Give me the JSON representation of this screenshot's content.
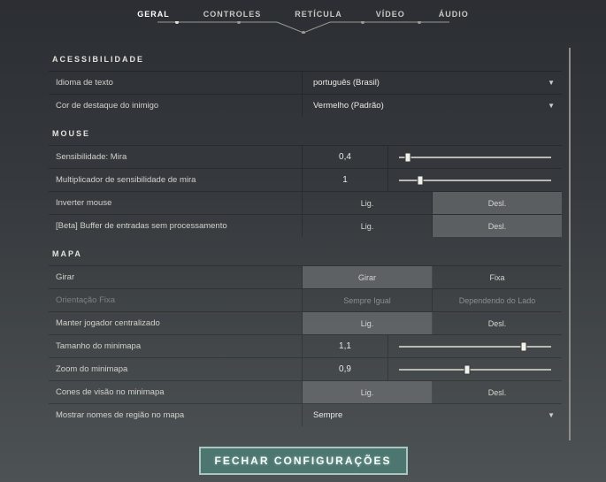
{
  "tabs": {
    "items": [
      "GERAL",
      "CONTROLES",
      "RETÍCULA",
      "VÍDEO",
      "ÁUDIO"
    ],
    "active_index": 0,
    "highlighted_index": 2
  },
  "sections": {
    "accessibility": {
      "title": "ACESSIBILIDADE",
      "language_label": "Idioma de texto",
      "language_value": "português (Brasil)",
      "enemy_color_label": "Cor de destaque do inimigo",
      "enemy_color_value": "Vermelho (Padrão)"
    },
    "mouse": {
      "title": "MOUSE",
      "sensitivity_label": "Sensibilidade: Mira",
      "sensitivity_value": "0,4",
      "sensitivity_pct": 6,
      "multiplier_label": "Multiplicador de sensibilidade de mira",
      "multiplier_value": "1",
      "multiplier_pct": 14,
      "invert_label": "Inverter mouse",
      "rawinput_label": "[Beta] Buffer de entradas sem processamento",
      "on": "Lig.",
      "off": "Desl."
    },
    "map": {
      "title": "MAPA",
      "rotate_label": "Girar",
      "rotate_opt_a": "Girar",
      "rotate_opt_b": "Fixa",
      "fixed_orient_label": "Orientação Fixa",
      "fixed_orient_a": "Sempre Igual",
      "fixed_orient_b": "Dependendo do Lado",
      "center_label": "Manter jogador centralizado",
      "size_label": "Tamanho do minimapa",
      "size_value": "1,1",
      "size_pct": 82,
      "zoom_label": "Zoom do minimapa",
      "zoom_value": "0,9",
      "zoom_pct": 45,
      "cones_label": "Cones de visão no minimapa",
      "region_label": "Mostrar nomes de região no mapa",
      "region_value": "Sempre",
      "on": "Lig.",
      "off": "Desl."
    }
  },
  "close_label": "FECHAR CONFIGURAÇÕES"
}
